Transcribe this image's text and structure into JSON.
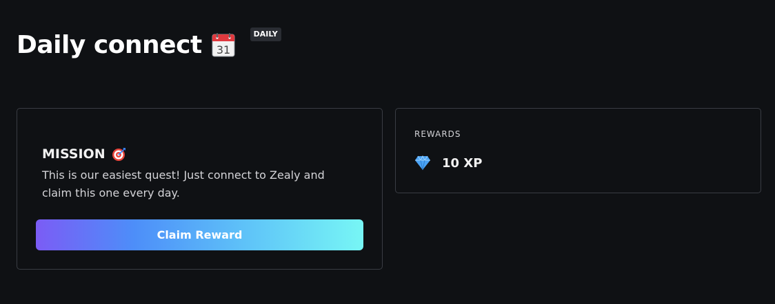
{
  "quest": {
    "title": "Daily connect",
    "title_icon": "calendar-icon",
    "badge": "DAILY"
  },
  "mission": {
    "heading": "MISSION",
    "heading_icon": "target-icon",
    "description": "This is our easiest quest! Just connect to Zealy and claim this one every day.",
    "button_label": "Claim Reward"
  },
  "rewards": {
    "heading": "REWARDS",
    "icon": "diamond-icon",
    "value": "10 XP"
  },
  "colors": {
    "background": "#0f1114",
    "card_border": "#3a3d44",
    "badge_bg": "#2a2d33",
    "button_gradient_start": "#7b5cf5",
    "button_gradient_end": "#77f6f5",
    "diamond": "#4aa3f5"
  }
}
